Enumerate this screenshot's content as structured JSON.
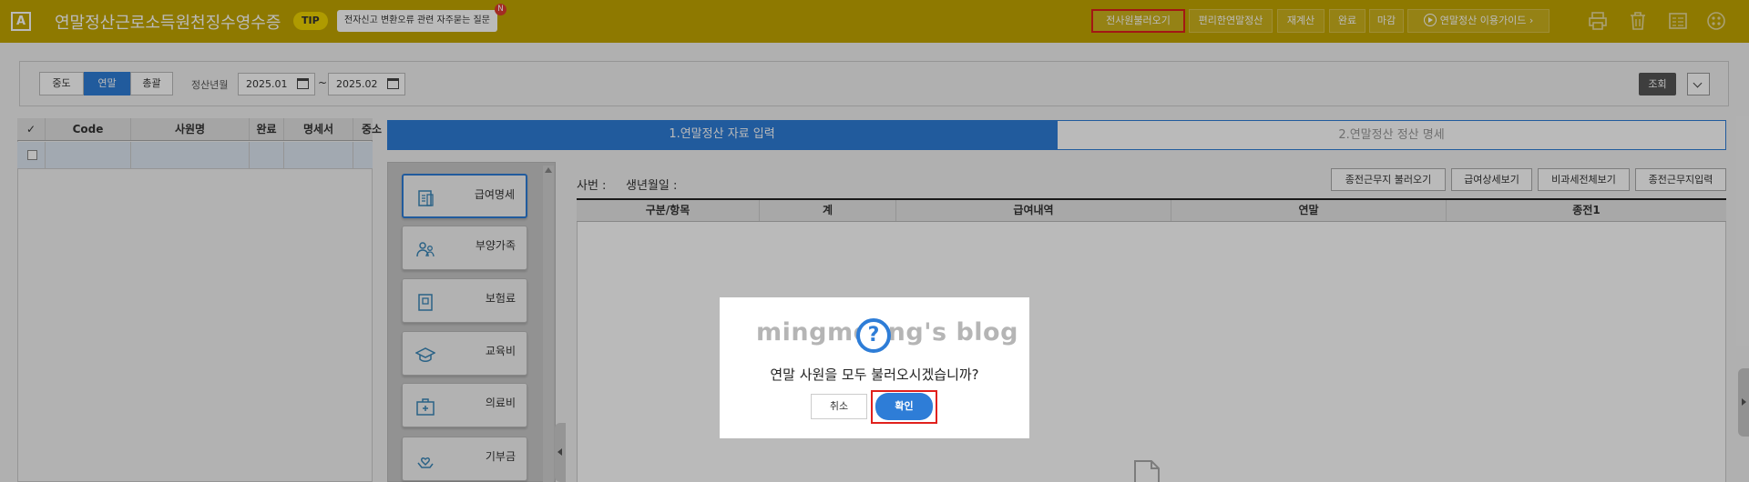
{
  "header": {
    "app_badge": "A",
    "title": "연말정산근로소득원천징수영수증",
    "tip_badge": "TIP",
    "tip_text": "전자신고 변환오류 관련 자주묻는 질문",
    "tip_new": "N",
    "buttons": [
      {
        "label": "전사원불러오기",
        "highlighted": true
      },
      {
        "label": "편리한연말정산"
      },
      {
        "label": "재계산"
      },
      {
        "label": "완료"
      },
      {
        "label": "마감"
      },
      {
        "label": "연말정산 이용가이드 ›"
      }
    ],
    "icons": [
      "print-icon",
      "trash-icon",
      "form-icon",
      "settings-icon"
    ]
  },
  "filter": {
    "segments": [
      {
        "label": "중도",
        "active": false
      },
      {
        "label": "연말",
        "active": true
      },
      {
        "label": "총괄",
        "active": false
      }
    ],
    "period_label": "정산년월",
    "date_from": "2025.01",
    "tilde": "~",
    "date_to": "2025.02",
    "search_button": "조회"
  },
  "employee_grid": {
    "check_header": "✓",
    "columns": [
      "Code",
      "사원명",
      "완료",
      "명세서",
      "중소"
    ]
  },
  "tabs": [
    {
      "label": "1.연말정산 자료 입력",
      "active": true
    },
    {
      "label": "2.연말정산 정산 명세",
      "active": false
    }
  ],
  "categories": [
    {
      "label": "급여명세",
      "active": true
    },
    {
      "label": "부양가족"
    },
    {
      "label": "보험료"
    },
    {
      "label": "교육비"
    },
    {
      "label": "의료비"
    },
    {
      "label": "기부금"
    }
  ],
  "info": {
    "employee_no_label": "사번 :",
    "birth_label": "생년월일 :"
  },
  "actions": [
    "종전근무지 불러오기",
    "급여상세보기",
    "비과세전체보기",
    "종전근무지입력"
  ],
  "main_grid": {
    "columns": [
      "구분/항목",
      "계",
      "급여내역",
      "연말",
      "종전1"
    ]
  },
  "modal": {
    "watermark": "mingmoong's blog",
    "question_icon": "?",
    "message": "연말 사원을 모두 불러오시겠습니까?",
    "cancel": "취소",
    "confirm": "확인"
  },
  "colors": {
    "header_bg": "#c3a600",
    "accent_blue": "#2e7dd7",
    "highlight_red": "#e0201c"
  }
}
